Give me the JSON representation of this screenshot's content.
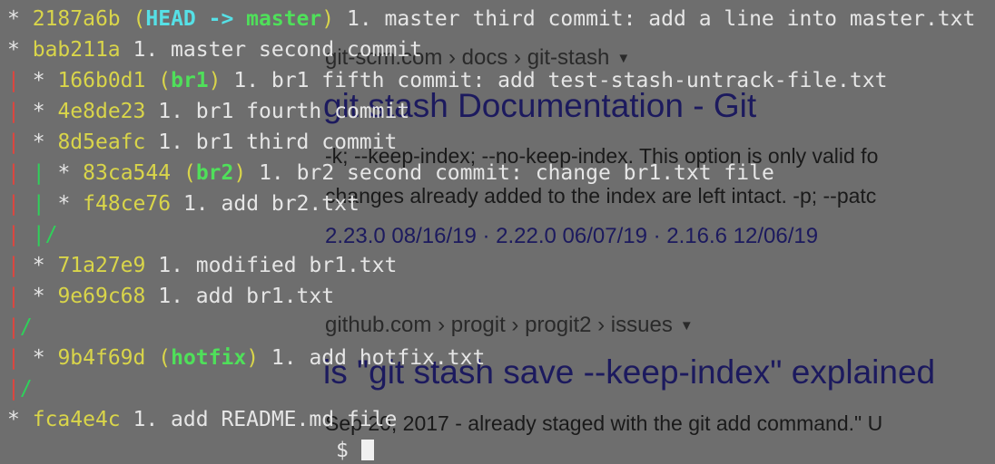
{
  "search_results": [
    {
      "breadcrumb": "git-scm.com › docs › git-stash",
      "title": "git stash Documentation - Git",
      "snippet_lines": [
        "-k; --keep-index; --no-keep-index. This option is only valid fo",
        "changes already added to the index are left intact. -p; --patc"
      ],
      "versions": "2.23.0 08/16/19 · 2.22.0 06/07/19 · 2.16.6 12/06/19"
    },
    {
      "breadcrumb": "github.com › progit › progit2 › issues",
      "title": "is \"git stash save --keep-index\" explained",
      "snippet_lines": [
        "Sep 20, 2017 - already staged with the git add command.\" U"
      ]
    }
  ],
  "git_log": [
    {
      "graph": "* ",
      "hash": "2187a6b",
      "refs": [
        {
          "name": "HEAD -> ",
          "kind": "head"
        },
        {
          "name": "master",
          "kind": "branch"
        }
      ],
      "msg": "1. master third commit: add a line into master.txt"
    },
    {
      "graph": "* ",
      "hash": "bab211a",
      "refs": [],
      "msg": "1. master second commit"
    },
    {
      "graph": "| * ",
      "hash": "166b0d1",
      "refs": [
        {
          "name": "br1",
          "kind": "branch"
        }
      ],
      "msg": "1. br1 fifth commit: add test-stash-untrack-file.txt"
    },
    {
      "graph": "| * ",
      "hash": "4e8de23",
      "refs": [],
      "msg": "1. br1 fourth commit"
    },
    {
      "graph": "| * ",
      "hash": "8d5eafc",
      "refs": [],
      "msg": "1. br1 third commit"
    },
    {
      "graph": "| | * ",
      "hash": "83ca544",
      "refs": [
        {
          "name": "br2",
          "kind": "branch"
        }
      ],
      "msg": "1. br2 second commit: change br1.txt file"
    },
    {
      "graph": "| | * ",
      "hash": "f48ce76",
      "refs": [],
      "msg": "1. add br2.txt"
    },
    {
      "graph": "| |/",
      "hash": "",
      "refs": [],
      "msg": ""
    },
    {
      "graph": "| * ",
      "hash": "71a27e9",
      "refs": [],
      "msg": "1. modified br1.txt"
    },
    {
      "graph": "| * ",
      "hash": "9e69c68",
      "refs": [],
      "msg": "1. add br1.txt"
    },
    {
      "graph": "|/",
      "hash": "",
      "refs": [],
      "msg": ""
    },
    {
      "graph": "| * ",
      "hash": "9b4f69d",
      "refs": [
        {
          "name": "hotfix",
          "kind": "branch"
        }
      ],
      "msg": "1. add hotfix.txt"
    },
    {
      "graph": "|/",
      "hash": "",
      "refs": [],
      "msg": ""
    },
    {
      "graph": "* ",
      "hash": "fca4e4c",
      "refs": [],
      "msg": "1. add README.md file"
    }
  ],
  "prompt_tail": "$ "
}
